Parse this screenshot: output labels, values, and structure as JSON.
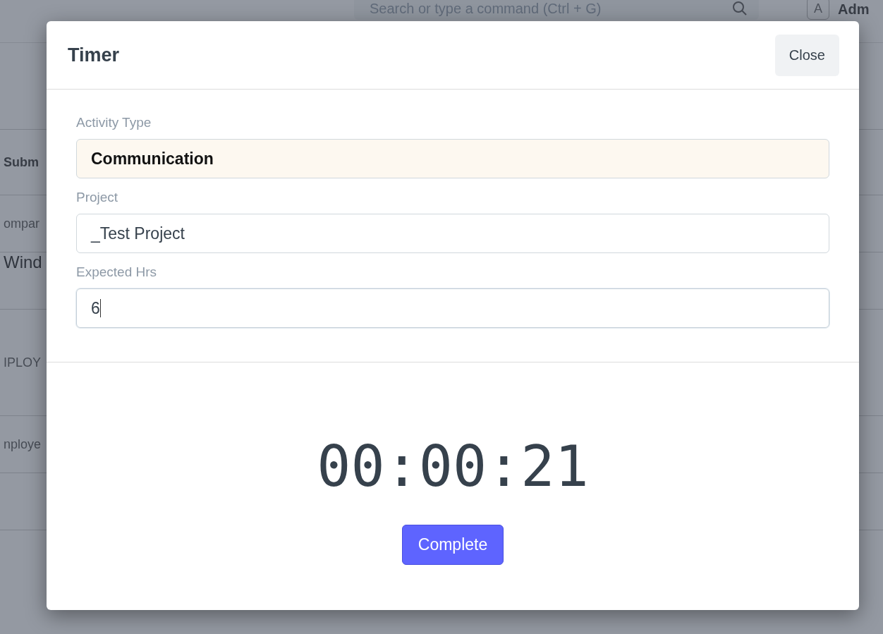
{
  "topbar": {
    "search": {
      "placeholder": "Search or type a command (Ctrl + G)"
    },
    "avatar": "A",
    "user": "Adm"
  },
  "background_rows": [
    {
      "kind": "bold",
      "text": "Subm"
    },
    {
      "kind": "label",
      "text": "ompar"
    },
    {
      "kind": "value",
      "text": "Wind"
    },
    {
      "kind": "heading",
      "text": "IPLOY"
    },
    {
      "kind": "label",
      "text": "nploye"
    }
  ],
  "dialog": {
    "title": "Timer",
    "close": "Close",
    "fields": [
      {
        "label": "Activity Type",
        "value": "Communication",
        "highlighted": true,
        "focused": false
      },
      {
        "label": "Project",
        "value": "_Test Project",
        "highlighted": false,
        "focused": false
      },
      {
        "label": "Expected Hrs",
        "value": "6",
        "highlighted": false,
        "focused": true
      }
    ],
    "timer": "00:00:21",
    "complete": "Complete"
  }
}
